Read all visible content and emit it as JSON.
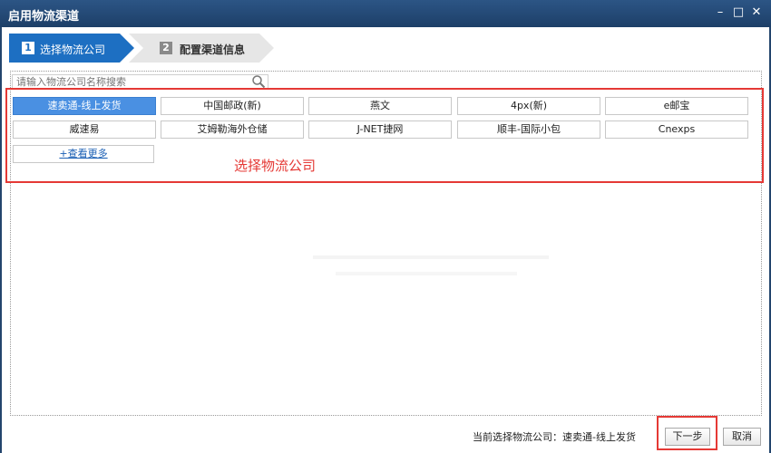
{
  "window": {
    "title": "启用物流渠道",
    "controls": [
      "minimize-icon",
      "maximize-icon",
      "close-icon"
    ]
  },
  "steps": [
    {
      "number": "1",
      "label": "选择物流公司",
      "active": true
    },
    {
      "number": "2",
      "label": "配置渠道信息",
      "active": false
    }
  ],
  "search": {
    "placeholder": "请输入物流公司名称搜索",
    "value": ""
  },
  "companies": [
    {
      "label": "速卖通-线上发货",
      "selected": true
    },
    {
      "label": "中国邮政(新)",
      "selected": false
    },
    {
      "label": "燕文",
      "selected": false
    },
    {
      "label": "4px(新)",
      "selected": false
    },
    {
      "label": "e邮宝",
      "selected": false
    },
    {
      "label": "威速易",
      "selected": false
    },
    {
      "label": "艾姆勒海外仓储",
      "selected": false
    },
    {
      "label": "J-NET捷网",
      "selected": false
    },
    {
      "label": "顺丰-国际小包",
      "selected": false
    },
    {
      "label": "Cnexps",
      "selected": false
    }
  ],
  "more_link": "+查看更多",
  "annotation": "选择物流公司",
  "footer": {
    "current_selection": "当前选择物流公司：速卖通-线上发货",
    "next_label": "下一步",
    "cancel_label": "取消"
  },
  "colors": {
    "titlebar": "#1d3f68",
    "active_step": "#1d6fc2",
    "selected_company": "#4a90e2",
    "highlight_border": "#e53935"
  }
}
